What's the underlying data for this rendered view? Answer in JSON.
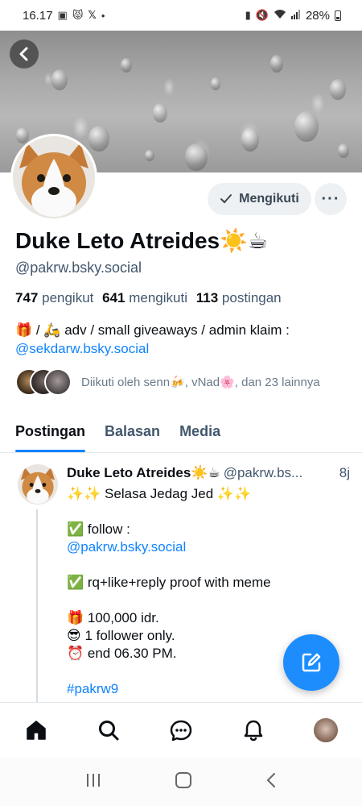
{
  "status_bar": {
    "time": "16.17",
    "battery": "28%",
    "notif_icons": [
      "image-icon",
      "app-icon",
      "x-icon",
      "dot"
    ],
    "system_icons": [
      "alarm-icon",
      "mute-icon",
      "wifi-icon",
      "signal-icon",
      "battery-icon"
    ]
  },
  "profile": {
    "display_name": "Duke Leto Atreides☀️☕",
    "handle": "@pakrw.bsky.social",
    "follow_button_label": "Mengikuti",
    "stats": {
      "followers_count": "747",
      "followers_label": "pengikut",
      "following_count": "641",
      "following_label": "mengikuti",
      "posts_count": "113",
      "posts_label": "postingan"
    },
    "bio_line1": "🎁 / 🛵 adv / small giveaways / admin klaim :",
    "bio_link": "@sekdarw.bsky.social",
    "followed_by_text": "Diikuti oleh senn🍻, vNad🌸, dan 23 lainnya"
  },
  "tabs": [
    {
      "label": "Postingan",
      "active": true
    },
    {
      "label": "Balasan",
      "active": false
    },
    {
      "label": "Media",
      "active": false
    }
  ],
  "post": {
    "author": "Duke Leto Atreides☀️☕",
    "handle": "@pakrw.bs...",
    "time": "8j",
    "title": "✨✨ Selasa Jedag Jed ✨✨",
    "follow_line": "✅ follow :",
    "follow_link": "@pakrw.bsky.social",
    "rq_line": "✅ rq+like+reply proof with meme",
    "prize_line": "🎁 100,000 idr.",
    "winner_line": "😎 1 follower only.",
    "end_line": "⏰  end 06.30 PM.",
    "hashtag": "#pakrw9"
  },
  "nav": {
    "items": [
      "home-icon",
      "search-icon",
      "chat-icon",
      "bell-icon",
      "profile-avatar"
    ]
  },
  "colors": {
    "accent": "#1083fe",
    "fab": "#1d8dfd",
    "muted_text": "#42576c"
  }
}
